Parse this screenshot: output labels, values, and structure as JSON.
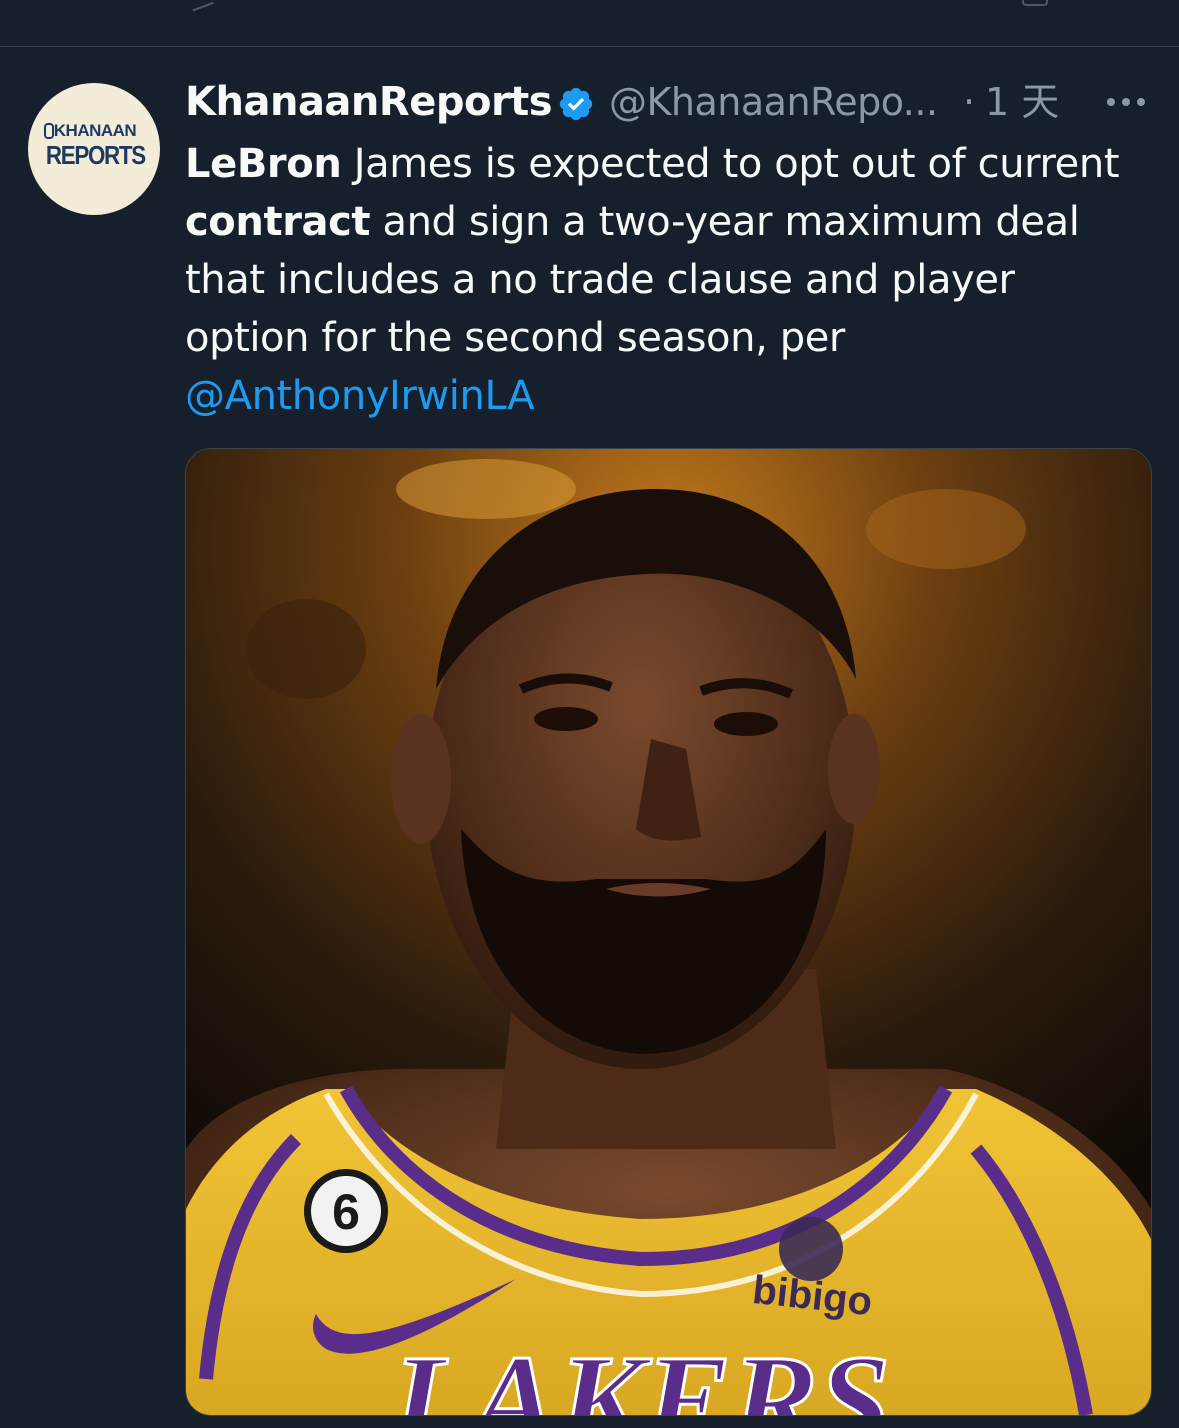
{
  "tweet": {
    "author": {
      "display_name": "KhanaanReports",
      "handle": "@KhanaanRepo...",
      "verified_icon": "verified-badge-icon",
      "avatar_text_line1": "KHANAAN",
      "avatar_text_line2": "REPORTS"
    },
    "separator": "·",
    "timestamp": "1 天",
    "more_icon": "more-horizontal-icon",
    "body": {
      "bold1": "LeBron",
      "text1": " James is expected to opt out of current ",
      "bold2": "contract",
      "text2": " and sign a two-year maximum deal that includes a no trade clause and player option for the second season, per ",
      "mention": "@AnthonyIrwinLA"
    },
    "media": {
      "jersey_number": "6",
      "sponsor": "bibigo",
      "team_text": "LAKERS"
    }
  },
  "colors": {
    "background": "#16202c",
    "text_primary": "#f7f9f9",
    "text_secondary": "#8b98a5",
    "link": "#1d9bf0",
    "divider": "#38444d"
  }
}
